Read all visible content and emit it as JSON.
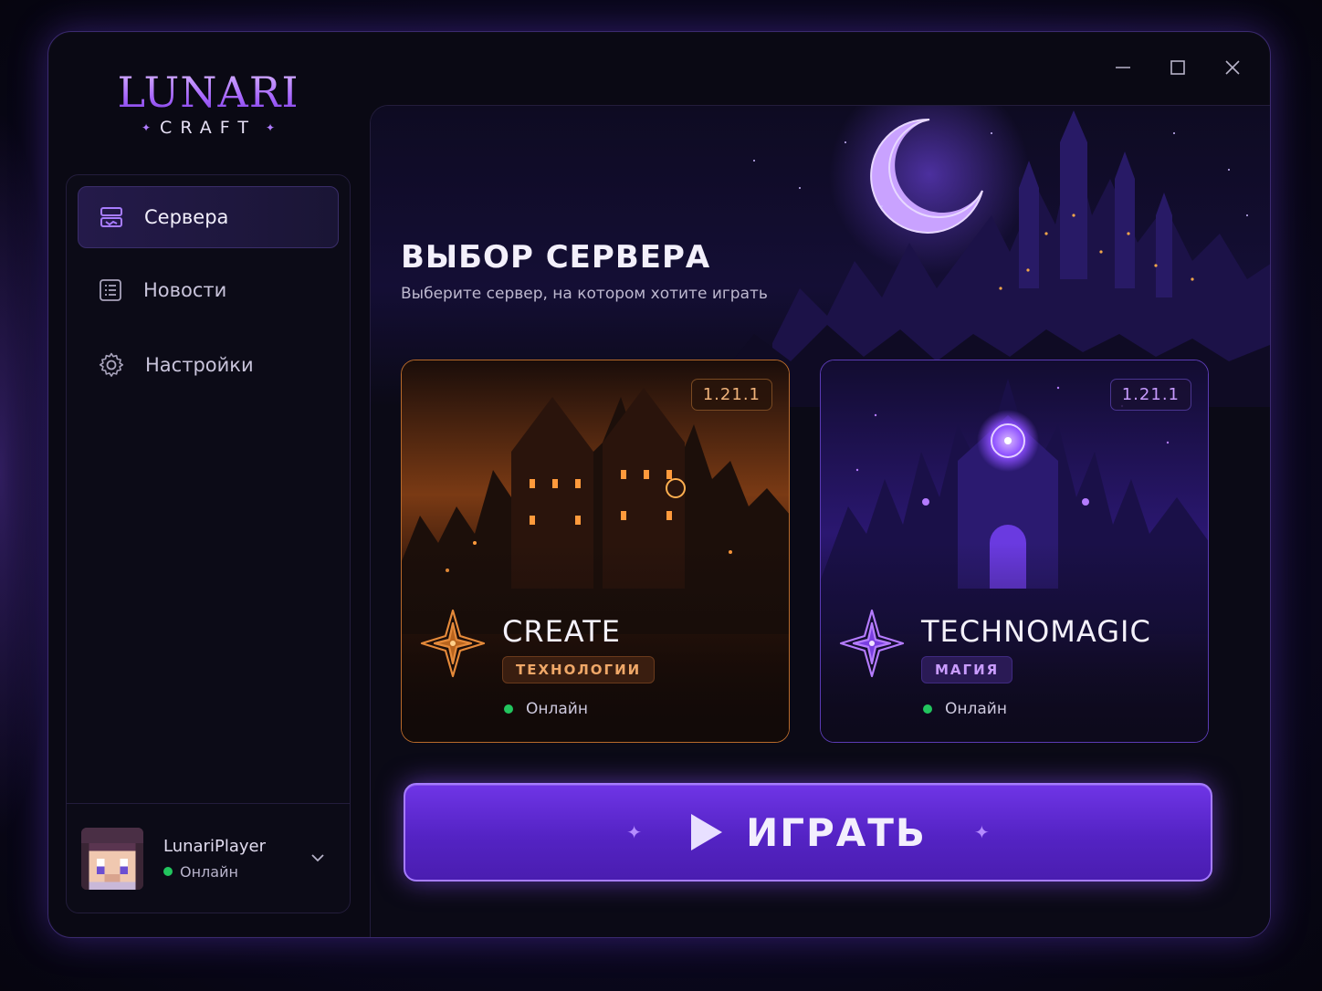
{
  "app": {
    "logo_main": "LUNARI",
    "logo_sub": "CRAFT"
  },
  "sidebar": {
    "items": [
      {
        "label": "Сервера",
        "icon": "server-icon",
        "active": true
      },
      {
        "label": "Новости",
        "icon": "news-icon",
        "active": false
      },
      {
        "label": "Настройки",
        "icon": "gear-icon",
        "active": false
      }
    ]
  },
  "profile": {
    "name": "LunariPlayer",
    "status": "Онлайн"
  },
  "main": {
    "title": "ВЫБОР СЕРВЕРА",
    "subtitle": "Выберите сервер, на котором хотите играть"
  },
  "servers": [
    {
      "name": "CREATE",
      "tag": "ТЕХНОЛОГИИ",
      "version": "1.21.1",
      "status": "Онлайн",
      "accent": "#e58a3a"
    },
    {
      "name": "TECHNOMAGIC",
      "tag": "МАГИЯ",
      "version": "1.21.1",
      "status": "Онлайн",
      "accent": "#a867ff"
    }
  ],
  "play": {
    "label": "ИГРАТЬ"
  },
  "colors": {
    "accent": "#6f35e6",
    "online": "#22c55e"
  }
}
